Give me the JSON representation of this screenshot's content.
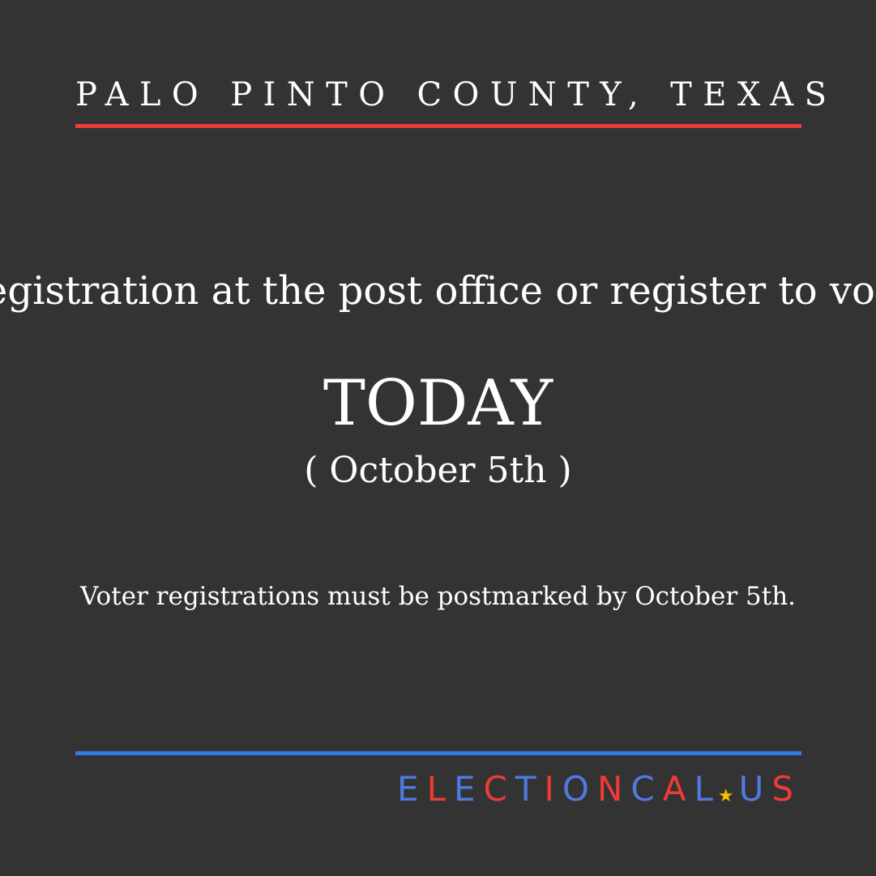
{
  "header": {
    "county": "PALO PINTO COUNTY, TEXAS"
  },
  "main": {
    "message": "Mail your registration at the post office or register to vote in person",
    "headline": "TODAY",
    "date": "( October 5th )",
    "note": "Voter registrations must be postmarked by October 5th."
  },
  "footer": {
    "logo_text": "ELECTIONCAL.US",
    "logo_part1": "ELECTIONCAL",
    "logo_part2": "US",
    "logo_star_icon": "star-icon"
  },
  "colors": {
    "background": "#333333",
    "top_rule": "#ef3b36",
    "bottom_rule": "#2f7bea",
    "logo_red": "#ef3b36",
    "logo_blue": "#4f7ae0",
    "logo_star": "#f2c200"
  }
}
